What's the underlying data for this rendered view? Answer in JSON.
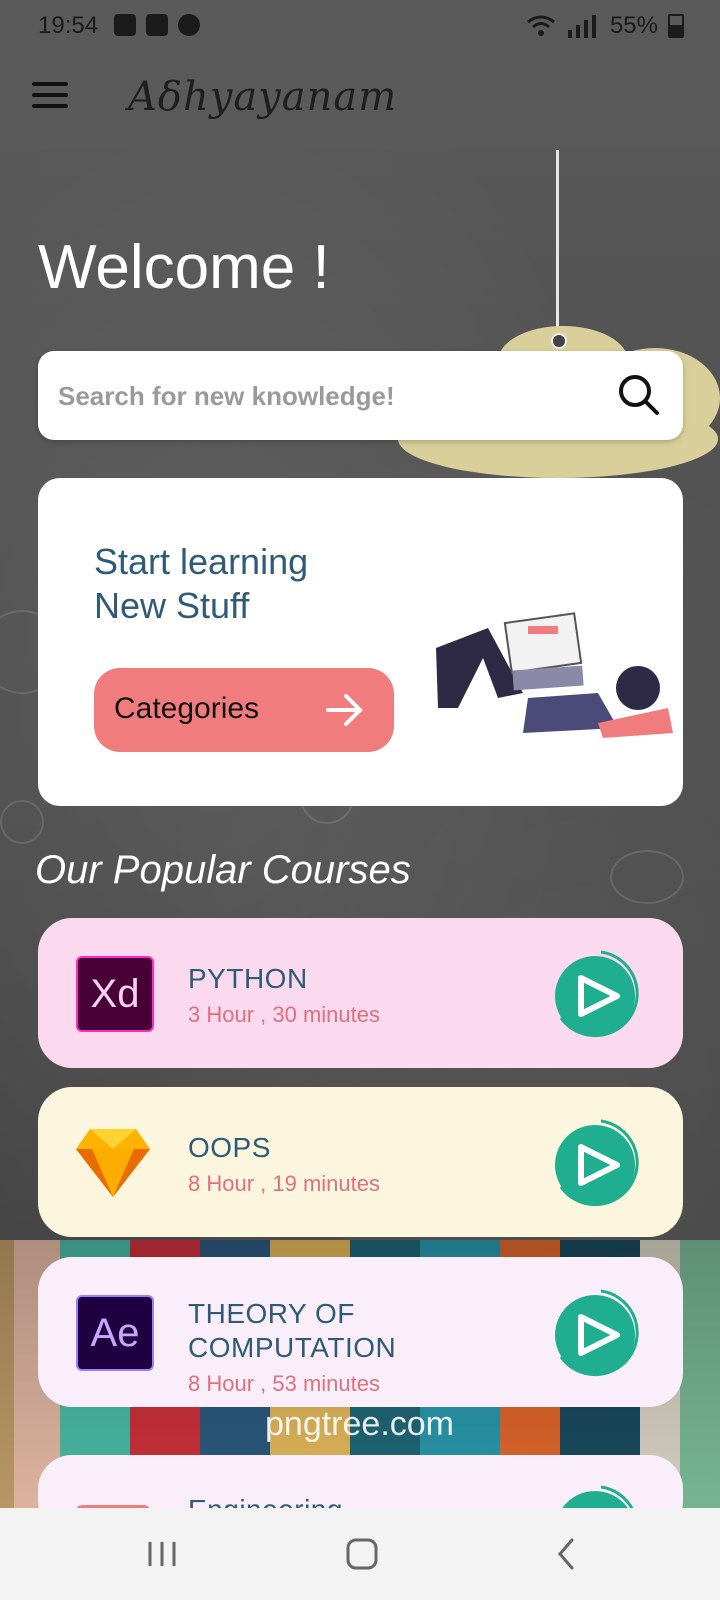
{
  "status_bar": {
    "time": "19:54",
    "battery": "55%"
  },
  "app_bar": {
    "title": "Aδhyayanam"
  },
  "welcome": "Welcome !",
  "search": {
    "placeholder": "Search for new knowledge!"
  },
  "promo": {
    "line1": "Start learning",
    "line2": "New Stuff",
    "button_label": "Categories"
  },
  "popular": {
    "title": "Our Popular Courses",
    "courses": [
      {
        "name_line1": "PYTHON",
        "name_line2": "",
        "duration": "3 Hour , 30 minutes",
        "logo_text": "Xd",
        "logo_icon": "adobe-xd-icon",
        "background": "#fbd9ef"
      },
      {
        "name_line1": "OOPS",
        "name_line2": "",
        "duration": "8 Hour , 19 minutes",
        "logo_text": "",
        "logo_icon": "sketch-diamond-icon",
        "background": "#fdf6df"
      },
      {
        "name_line1": "THEORY OF",
        "name_line2": "COMPUTATION",
        "duration": "8 Hour , 53 minutes",
        "logo_text": "Ae",
        "logo_icon": "after-effects-icon",
        "background": "#fbeefb"
      },
      {
        "name_line1": "Engineering",
        "name_line2": "",
        "duration": "",
        "logo_text": "",
        "logo_icon": "course-icon",
        "background": "#fbeefb"
      }
    ]
  },
  "watermark": "pngtree.com",
  "colors": {
    "accent": "#f07c7e",
    "teal": "#1fae8f",
    "text": "#2f5a78"
  }
}
